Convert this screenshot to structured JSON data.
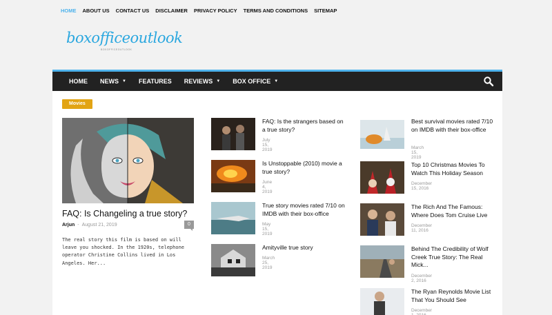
{
  "top_menu": [
    {
      "label": "HOME",
      "active": true
    },
    {
      "label": "ABOUT US",
      "active": false
    },
    {
      "label": "CONTACT US",
      "active": false
    },
    {
      "label": "DISCLAIMER",
      "active": false
    },
    {
      "label": "PRIVACY POLICY",
      "active": false
    },
    {
      "label": "TERMS AND CONDITIONS",
      "active": false
    },
    {
      "label": "SITEMAP",
      "active": false
    }
  ],
  "logo": {
    "text": "boxofficeoutlook",
    "tagline": "BOXOFFICEOUTLOOK"
  },
  "main_nav": [
    {
      "label": "HOME",
      "dropdown": false
    },
    {
      "label": "NEWS",
      "dropdown": true
    },
    {
      "label": "FEATURES",
      "dropdown": false
    },
    {
      "label": "REVIEWS",
      "dropdown": true
    },
    {
      "label": "BOX OFFICE",
      "dropdown": true
    }
  ],
  "section_badge": "Movies",
  "featured": {
    "title": "FAQ: Is Changeling a true story?",
    "author": "Arjun",
    "separator": "-",
    "date": "August 21, 2019",
    "comments": "0",
    "excerpt": "The real story this film is based on will leave you shocked. In the 1920s, telephone operator Christine Collins lived in Los Angeles. Her..."
  },
  "middle_posts": [
    {
      "title": "FAQ: Is the strangers based on a true story?",
      "date": "July 15, 2019"
    },
    {
      "title": "Is Unstoppable (2010) movie a true story?",
      "date": "June 4, 2019"
    },
    {
      "title": "True story movies rated 7/10 on IMDB with their box-office",
      "date": "May 15, 2019"
    },
    {
      "title": "Amityville true story",
      "date": "March 25, 2019"
    }
  ],
  "right_posts": [
    {
      "title": "Best survival movies rated 7/10 on IMDB with their box-office",
      "date": "March 15, 2019"
    },
    {
      "title": "Top 10 Christmas Movies To Watch This Holiday Season",
      "date": "December 15, 2016"
    },
    {
      "title": "The Rich And The Famous: Where Does Tom Cruise Live",
      "date": "December 11, 2016"
    },
    {
      "title": "Behind The Credibility of Wolf Creek True Story: The Real Mick...",
      "date": "December 2, 2016"
    },
    {
      "title": "The Ryan Reynolds Movie List That You Should See",
      "date": "December 1, 2016"
    }
  ],
  "colors": {
    "accent": "#4db2ec",
    "badge": "#e2a414",
    "nav_bg": "#222222"
  },
  "icons": {
    "search": "search-icon",
    "dropdown": "chevron-down-icon"
  }
}
